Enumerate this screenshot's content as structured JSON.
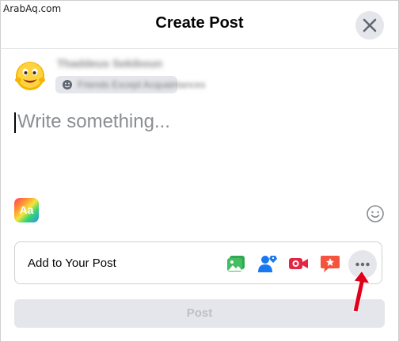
{
  "watermark": "ArabAq.com",
  "dialog": {
    "title": "Create Post",
    "close_icon": "close-icon"
  },
  "user": {
    "name": "Thaddeus Sekiboun",
    "audience": "Friends Except Acquaintances"
  },
  "composer": {
    "placeholder": "Write something..."
  },
  "toolbar": {
    "background_icon": "Aa",
    "emoji_icon": "smile-icon"
  },
  "add_to_post": {
    "label": "Add to Your Post",
    "tools": [
      "photo-video-icon",
      "tag-people-icon",
      "live-video-icon",
      "feeling-activity-icon",
      "more-icon"
    ]
  },
  "post_button": "Post",
  "colors": {
    "photo": "#45bd62",
    "tag": "#1877f2",
    "live": "#e42645",
    "feeling": "#f5533d",
    "annotation_arrow": "#e0001a",
    "disabled_button": "#e4e6eb"
  }
}
